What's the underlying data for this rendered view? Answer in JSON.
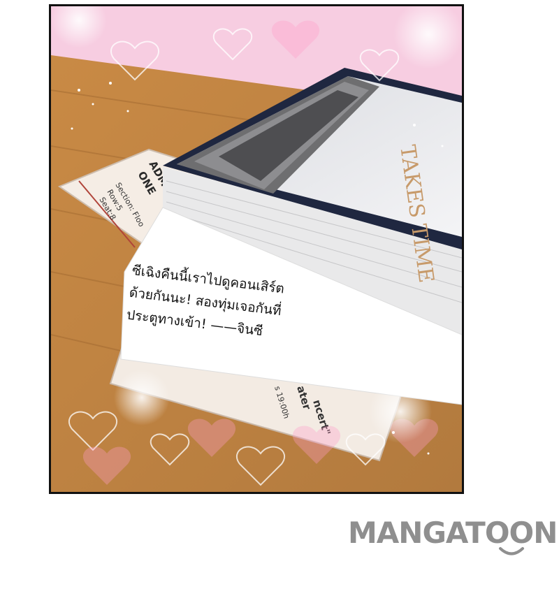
{
  "note": {
    "text": "ซีเฉิงคืนนี้เราไปดูคอนเสิร์ต\nด้วยกันนะ! สองทุ่มเจอกันที่\nประตูทางเข้า! ——จินซี"
  },
  "ticket": {
    "admit_line1": "ADMIT",
    "admit_line2": "ONE",
    "section": "Section: Floo",
    "row": "Row:5",
    "seat": "Seat:8",
    "bottom_line1": "ncert\"",
    "bottom_line2": "ater",
    "bottom_time": "s 19:00h"
  },
  "book": {
    "cover_title": "TAKES TIME"
  },
  "brand": {
    "logo": "MANGATOON"
  }
}
